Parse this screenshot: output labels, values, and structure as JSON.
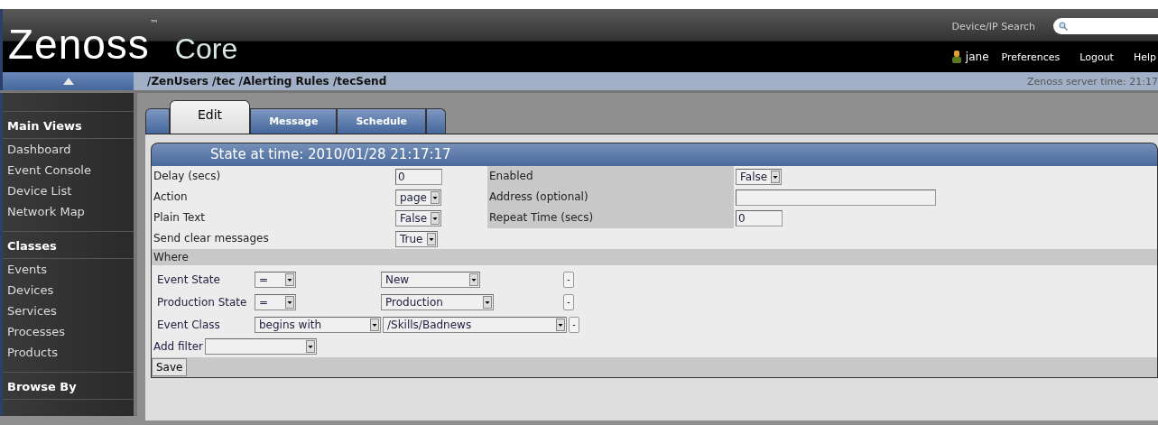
{
  "header": {
    "logo": "Zenoss",
    "trademark": "™",
    "product": "Core",
    "search_label": "Device/IP Search",
    "user": "jane",
    "links": [
      "Preferences",
      "Logout",
      "Help"
    ]
  },
  "breadcrumb": "/ZenUsers /tec /Alerting Rules /tecSend",
  "server_time": "Zenoss server time: 21:17",
  "sidebar": {
    "sections": [
      {
        "title": "Main Views",
        "items": [
          "Dashboard",
          "Event Console",
          "Device List",
          "Network Map"
        ]
      },
      {
        "title": "Classes",
        "items": [
          "Events",
          "Devices",
          "Services",
          "Processes",
          "Products"
        ]
      },
      {
        "title": "Browse By"
      }
    ]
  },
  "tabs": [
    {
      "label": "Edit",
      "selected": true
    },
    {
      "label": "Message",
      "selected": false
    },
    {
      "label": "Schedule",
      "selected": false
    }
  ],
  "panel_title": "State at time: 2010/01/28 21:17:17",
  "rows": [
    {
      "left": {
        "label": "Delay (secs)",
        "kind": "text",
        "value": "0"
      },
      "right": {
        "label": "Enabled",
        "kind": "select",
        "value": "False"
      }
    },
    {
      "left": {
        "label": "Action",
        "kind": "select",
        "value": "page"
      },
      "right": {
        "label": "Address (optional)",
        "kind": "wide"
      }
    },
    {
      "left": {
        "label": "Plain Text",
        "kind": "select",
        "value": "False"
      },
      "right": {
        "label": "Repeat Time (secs)",
        "kind": "text",
        "value": "0"
      }
    },
    {
      "left": {
        "label": "Send clear messages",
        "kind": "select",
        "value": "True"
      },
      "right": null
    }
  ],
  "where_label": "Where",
  "filters": [
    {
      "label": "Event State",
      "operator": "=",
      "value": "New",
      "remove": "-",
      "kind": "short"
    },
    {
      "label": "Production State",
      "operator": "=",
      "value": "Production",
      "remove": "-",
      "kind": "short"
    },
    {
      "label": "Event Class",
      "operator": "begins with",
      "value": "/Skills/Badnews",
      "remove": "-",
      "kind": "long"
    }
  ],
  "add_filter": {
    "label": "Add filter"
  },
  "save": "Save"
}
